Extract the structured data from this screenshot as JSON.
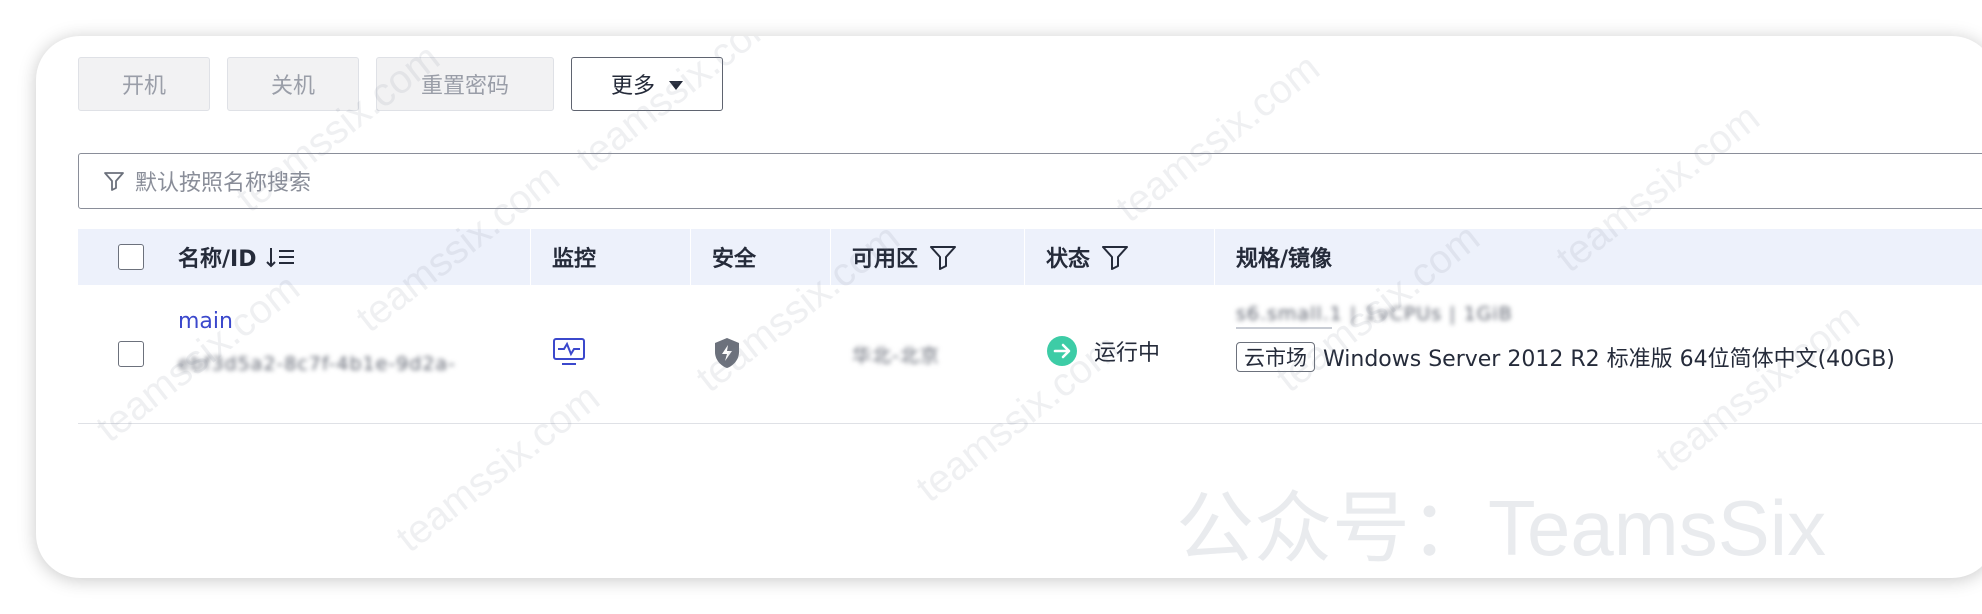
{
  "toolbar": {
    "power_on_label": "开机",
    "power_off_label": "关机",
    "reset_password_label": "重置密码",
    "more_label": "更多"
  },
  "search": {
    "placeholder": "默认按照名称搜索"
  },
  "table": {
    "headers": {
      "name_id": "名称/ID",
      "monitor": "监控",
      "security": "安全",
      "zone": "可用区",
      "status": "状态",
      "spec_image": "规格/镜像"
    },
    "rows": [
      {
        "name": "main",
        "id_blurred": "ebf3d5a2-8c7f-4b1e-9d2a-",
        "zone_blurred": "华北-北京",
        "status": "运行中",
        "spec_blurred": "s6.small.1 | 1vCPUs | 1GiB",
        "image_tag": "云市场",
        "image_name": "Windows Server 2012 R2 标准版 64位简体中文(40GB)"
      }
    ]
  },
  "watermark": {
    "text": "teamssix.com",
    "wechat": "公众号：TeamsSix"
  },
  "colors": {
    "accent": "#3b48cc",
    "status_running": "#3dcca6",
    "header_bg": "#edf1fb"
  }
}
